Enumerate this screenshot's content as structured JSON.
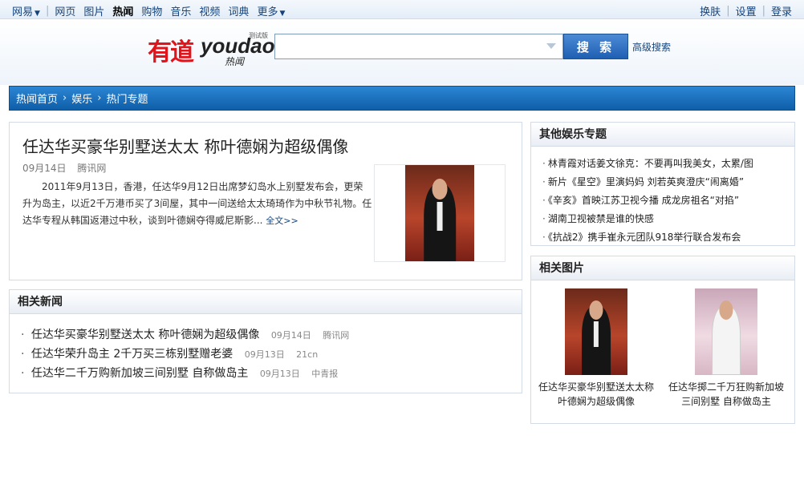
{
  "topnav": {
    "brand": "网易",
    "items": [
      "网页",
      "图片",
      "热闻",
      "购物",
      "音乐",
      "视频",
      "词典",
      "更多"
    ],
    "active": "热闻",
    "right": [
      "换肤",
      "设置",
      "登录"
    ]
  },
  "logo": {
    "main": "有道",
    "word": "youdao",
    "beta": "测试版",
    "sub": "热闻"
  },
  "search": {
    "value": "",
    "button": "搜 索",
    "advanced": "高级搜索"
  },
  "breadcrumb": [
    "热闻首页",
    "娱乐",
    "热门专题"
  ],
  "article": {
    "title": "任达华买豪华别墅送太太  称叶德娴为超级偶像",
    "date": "09月14日",
    "source": "腾讯网",
    "summary": "2011年9月13日，香港，任达华9月12日出席梦幻岛水上别墅发布会，更荣升为岛主，以近2千万港币买了3间屋，其中一间送给太太琦琦作为中秋节礼物。任达华专程从韩国返港过中秋，谈到叶德娴夺得威尼斯影...",
    "more": "全文>>"
  },
  "related_news": {
    "title": "相关新闻",
    "items": [
      {
        "text": "任达华买豪华别墅送太太  称叶德娴为超级偶像",
        "date": "09月14日",
        "source": "腾讯网"
      },
      {
        "text": "任达华荣升岛主  2千万买三栋别墅赠老婆",
        "date": "09月13日",
        "source": "21cn"
      },
      {
        "text": "任达华二千万购新加坡三间别墅  自称做岛主",
        "date": "09月13日",
        "source": "中青报"
      }
    ]
  },
  "other_topics": {
    "title": "其他娱乐专题",
    "items": [
      "林青霞对话姜文徐克：不要再叫我美女，太累/图",
      "新片《星空》里演妈妈  刘若英爽澄庆“闹离婚”",
      "《辛亥》首映江苏卫视今播  成龙房祖名“对掐”",
      "湖南卫视被禁是谁的快感",
      "《抗战2》携手崔永元团队918举行联合发布会"
    ]
  },
  "related_pics": {
    "title": "相关图片",
    "items": [
      {
        "caption": "任达华买豪华别墅送太太称叶德娴为超级偶像"
      },
      {
        "caption": "任达华掷二千万狂购新加坡三间别墅 自称做岛主"
      }
    ]
  },
  "colors": {
    "link": "#15447c",
    "breadcrumb_bg": "#1a6dbb",
    "logo_red": "#e0141b",
    "search_btn": "#2f6fc0"
  }
}
